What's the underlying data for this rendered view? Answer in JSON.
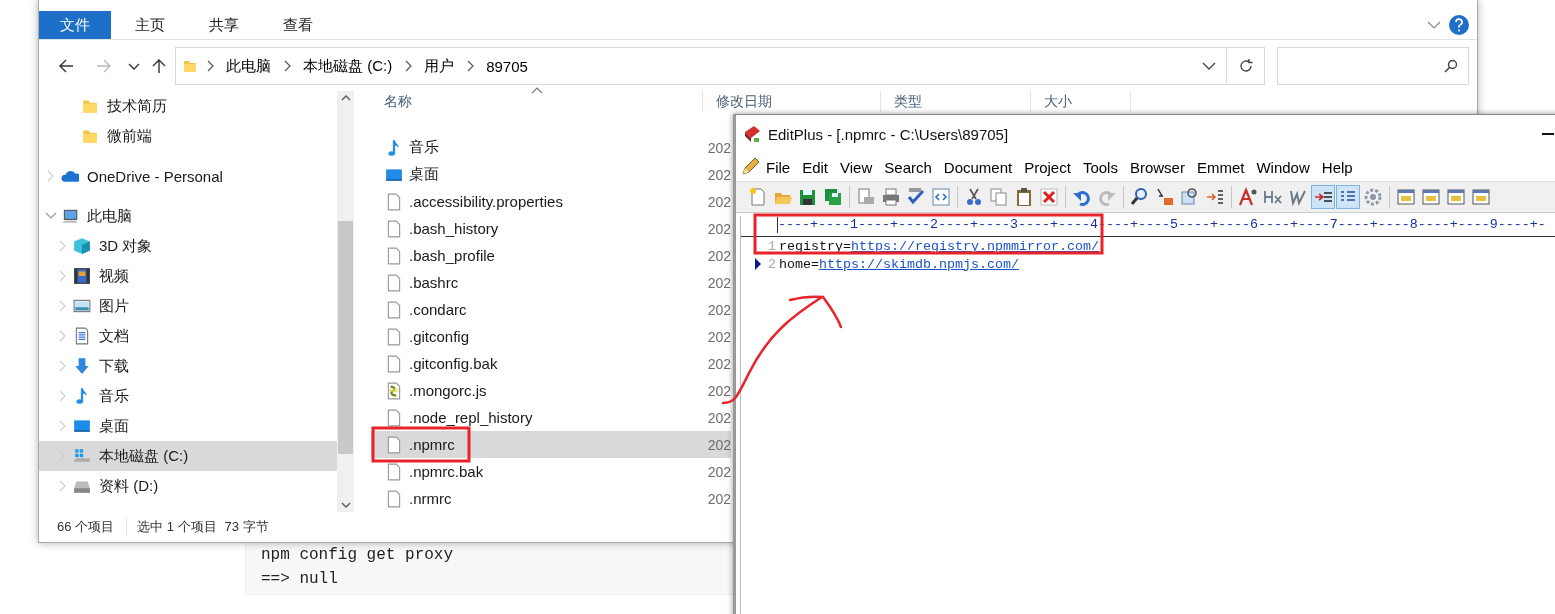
{
  "background": {
    "code_lines": [
      "npm config get proxy",
      "==> null"
    ]
  },
  "explorer": {
    "ribbon_tabs": [
      {
        "label": "文件",
        "selected": true
      },
      {
        "label": "主页",
        "selected": false
      },
      {
        "label": "共享",
        "selected": false
      },
      {
        "label": "查看",
        "selected": false
      }
    ],
    "address": {
      "crumbs": [
        "此电脑",
        "本地磁盘 (C:)",
        "用户",
        "89705"
      ]
    },
    "quick_access": [
      {
        "label": "技术简历",
        "kind": "folder",
        "selected": false
      },
      {
        "label": "微前端",
        "kind": "folder",
        "selected": false
      }
    ],
    "nav": [
      {
        "label": "OneDrive - Personal",
        "kind": "cloud",
        "expanded": false,
        "selected": false
      },
      {
        "label": "此电脑",
        "kind": "computer",
        "expanded": true,
        "selected": false,
        "children": [
          {
            "label": "3D 对象",
            "kind": "cube",
            "expanded": false,
            "selected": false
          },
          {
            "label": "视频",
            "kind": "film",
            "expanded": false,
            "selected": false
          },
          {
            "label": "图片",
            "kind": "image",
            "expanded": false,
            "selected": false
          },
          {
            "label": "文档",
            "kind": "document",
            "expanded": false,
            "selected": false
          },
          {
            "label": "下载",
            "kind": "download",
            "expanded": false,
            "selected": false
          },
          {
            "label": "音乐",
            "kind": "music",
            "expanded": false,
            "selected": false
          },
          {
            "label": "桌面",
            "kind": "desktop",
            "expanded": false,
            "selected": false
          },
          {
            "label": "本地磁盘 (C:)",
            "kind": "system-drive",
            "expanded": false,
            "selected": true
          },
          {
            "label": "资料 (D:)",
            "kind": "drive",
            "expanded": false,
            "selected": false
          }
        ]
      }
    ],
    "columns": [
      "名称",
      "修改日期",
      "类型",
      "大小"
    ],
    "files": [
      {
        "name": "音乐",
        "kind": "music",
        "date": "202",
        "selected": false
      },
      {
        "name": "桌面",
        "kind": "desktop",
        "date": "202",
        "selected": false
      },
      {
        "name": ".accessibility.properties",
        "kind": "file",
        "date": "202",
        "selected": false
      },
      {
        "name": ".bash_history",
        "kind": "file",
        "date": "202",
        "selected": false
      },
      {
        "name": ".bash_profile",
        "kind": "file",
        "date": "202",
        "selected": false
      },
      {
        "name": ".bashrc",
        "kind": "file",
        "date": "202",
        "selected": false
      },
      {
        "name": ".condarc",
        "kind": "file",
        "date": "202",
        "selected": false
      },
      {
        "name": ".gitconfig",
        "kind": "file",
        "date": "202",
        "selected": false
      },
      {
        "name": ".gitconfig.bak",
        "kind": "file",
        "date": "202",
        "selected": false
      },
      {
        "name": ".mongorc.js",
        "kind": "script",
        "date": "202",
        "selected": false
      },
      {
        "name": ".node_repl_history",
        "kind": "file",
        "date": "202",
        "selected": false
      },
      {
        "name": ".npmrc",
        "kind": "file",
        "date": "202",
        "selected": true
      },
      {
        "name": ".npmrc.bak",
        "kind": "file",
        "date": "202",
        "selected": false
      },
      {
        "name": ".nrmrc",
        "kind": "file",
        "date": "202",
        "selected": false
      }
    ],
    "status": {
      "count": "66 个项目",
      "selection": "选中 1 个项目",
      "size": "73 字节"
    }
  },
  "editplus": {
    "title": "EditPlus - [.npmrc - C:\\Users\\89705]",
    "menu": [
      "File",
      "Edit",
      "View",
      "Search",
      "Document",
      "Project",
      "Tools",
      "Browser",
      "Emmet",
      "Window",
      "Help"
    ],
    "toolbar": [
      {
        "pressed": false
      },
      {
        "pressed": false
      },
      {
        "pressed": false
      },
      {
        "pressed": false
      },
      {
        "pressed": false
      },
      {
        "pressed": false
      },
      {
        "pressed": false
      },
      {
        "pressed": false
      },
      {
        "pressed": false
      },
      {
        "pressed": false
      },
      {
        "pressed": false
      },
      {
        "pressed": false
      },
      {
        "pressed": false
      },
      {
        "pressed": false
      },
      {
        "pressed": false
      },
      {
        "pressed": false
      },
      {
        "pressed": false
      },
      {
        "pressed": false
      },
      {
        "pressed": false
      },
      {
        "pressed": false
      },
      {
        "pressed": false
      },
      {
        "pressed": true
      },
      {
        "pressed": true
      },
      {
        "pressed": false
      },
      {
        "pressed": false
      },
      {
        "pressed": false
      },
      {
        "pressed": false
      },
      {
        "pressed": false
      }
    ],
    "ruler": "----+----1----+----2----+----3----+----4----+----5----+----6----+----7----+----8----+----9----+-",
    "lines": [
      {
        "number": "1",
        "current": false,
        "parts": [
          {
            "kind": "text",
            "text": "registry="
          },
          {
            "kind": "link",
            "text": "https://registry.npmmirror.com/"
          }
        ]
      },
      {
        "number": "2",
        "current": true,
        "parts": [
          {
            "kind": "text",
            "text": "home="
          },
          {
            "kind": "link",
            "text": "https://skimdb.npmjs.com/"
          }
        ]
      }
    ]
  }
}
